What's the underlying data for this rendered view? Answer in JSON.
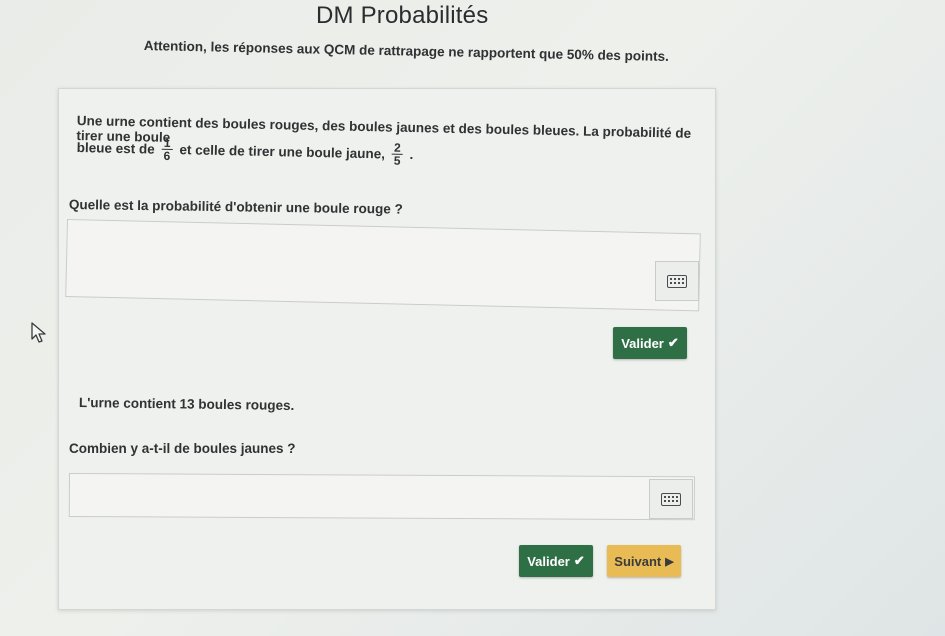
{
  "page": {
    "title": "DM Probabilités",
    "notice": "Attention, les réponses aux QCM de rattrapage ne rapportent que 50% des points."
  },
  "question1": {
    "line1": "Une urne contient des boules rouges, des boules jaunes et des boules bleues. La probabilité de tirer une boule",
    "line2_prefix": "bleue est de",
    "fraction_blue": {
      "numerator": "1",
      "denominator": "6"
    },
    "line2_middle": "et celle de tirer une boule jaune,",
    "fraction_yellow": {
      "numerator": "2",
      "denominator": "5"
    },
    "line2_suffix": ".",
    "prompt": "Quelle est la probabilité d'obtenir une boule rouge ?",
    "answer_value": "",
    "keyboard_icon": "keyboard-icon",
    "validate_label": "Valider",
    "validate_icon": "✔"
  },
  "question2": {
    "statement": "L'urne contient 13 boules rouges.",
    "prompt": "Combien y a-t-il de boules jaunes ?",
    "answer_value": "",
    "keyboard_icon": "keyboard-icon",
    "validate_label": "Valider",
    "validate_icon": "✔",
    "next_label": "Suivant",
    "next_icon": "▶"
  },
  "colors": {
    "validate_button": "#2f6f46",
    "next_button": "#e8bb55"
  }
}
